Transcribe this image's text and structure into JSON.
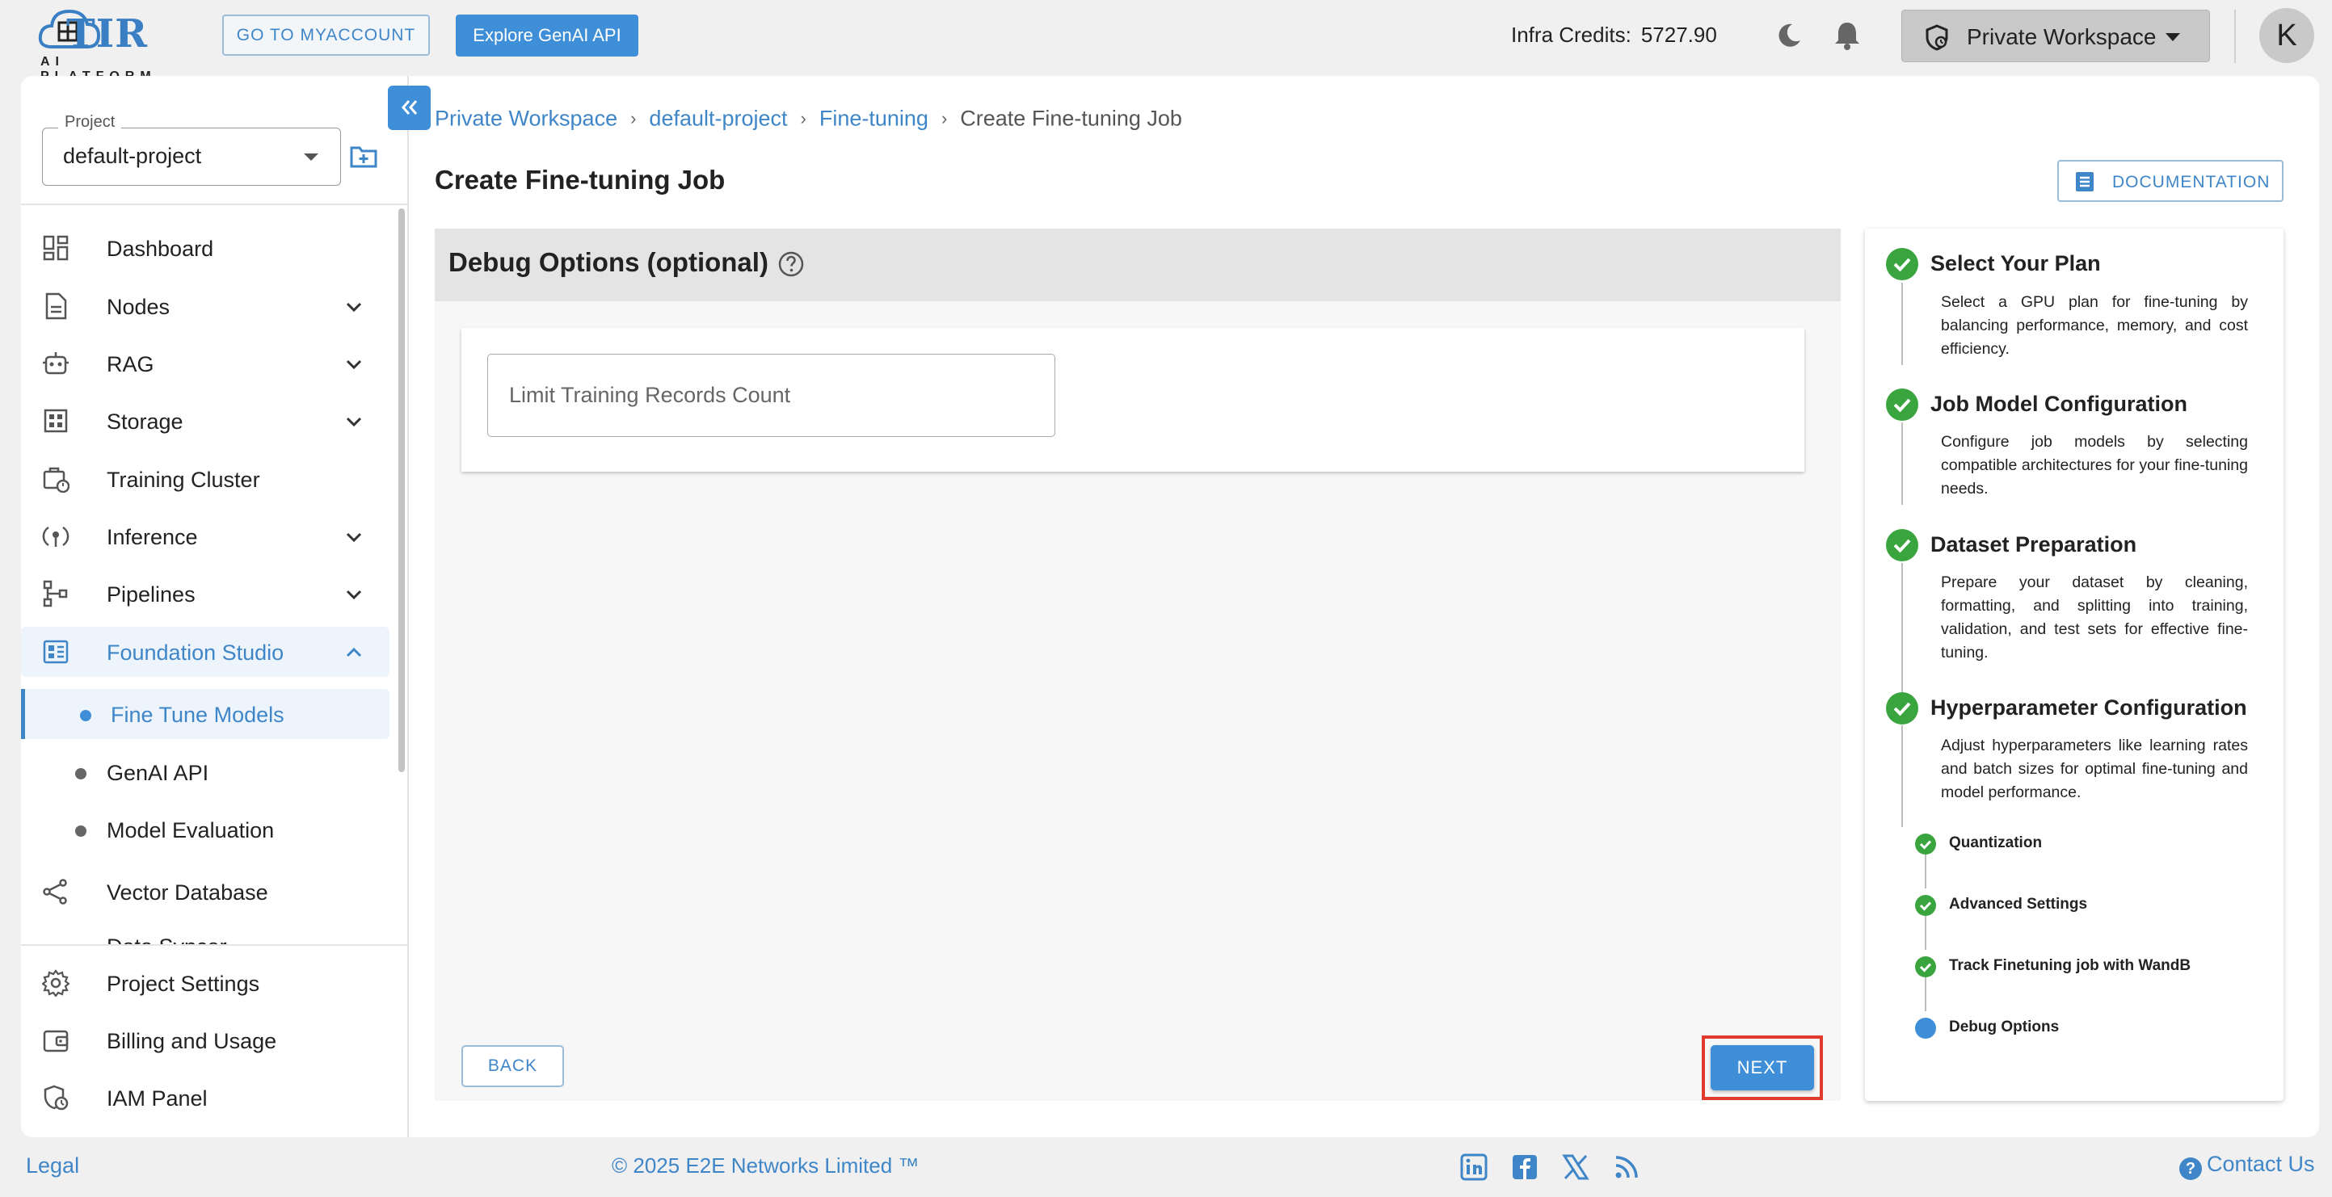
{
  "header": {
    "logo_text": "TIR",
    "logo_sub": "AI PLATFORM",
    "myaccount_label": "GO TO MYACCOUNT",
    "genai_label": "Explore GenAI API",
    "credits_label": "Infra Credits:",
    "credits_value": "5727.90",
    "workspace_label": "Private Workspace",
    "avatar_letter": "K",
    "icons": [
      "moon-icon",
      "bell-icon",
      "workspace-icon",
      "chevron-down-icon"
    ]
  },
  "sidebar": {
    "project_label": "Project",
    "project_value": "default-project",
    "items": [
      {
        "label": "Dashboard",
        "icon": "dashboard-icon"
      },
      {
        "label": "Nodes",
        "icon": "document-icon"
      },
      {
        "label": "RAG",
        "icon": "robot-icon"
      },
      {
        "label": "Storage",
        "icon": "storage-icon"
      },
      {
        "label": "Training Cluster",
        "icon": "cluster-icon"
      },
      {
        "label": "Inference",
        "icon": "inference-icon"
      },
      {
        "label": "Pipelines",
        "icon": "pipeline-icon"
      },
      {
        "label": "Foundation Studio",
        "icon": "studio-icon"
      }
    ],
    "sub_items": [
      {
        "label": "Fine Tune Models"
      },
      {
        "label": "GenAI API"
      },
      {
        "label": "Model Evaluation"
      }
    ],
    "after_items": [
      {
        "label": "Vector Database",
        "icon": "vector-icon"
      },
      {
        "label": "Data Syncer",
        "icon": "sync-icon"
      }
    ],
    "bottom_items": [
      {
        "label": "Project Settings",
        "icon": "gear-icon"
      },
      {
        "label": "Billing and Usage",
        "icon": "wallet-icon"
      },
      {
        "label": "IAM Panel",
        "icon": "iam-icon"
      }
    ]
  },
  "breadcrumb": [
    "Private Workspace",
    "default-project",
    "Fine-tuning",
    "Create Fine-tuning Job"
  ],
  "page_title": "Create Fine-tuning Job",
  "doc_label": "DOCUMENTATION",
  "form": {
    "section_title": "Debug Options (optional)",
    "limit_placeholder": "Limit Training Records Count",
    "limit_value": "",
    "back_label": "BACK",
    "next_label": "NEXT"
  },
  "stepper": {
    "steps": [
      {
        "title": "Select Your Plan",
        "desc": "Select a GPU plan for fine-tuning by balancing performance, memory, and cost efficiency."
      },
      {
        "title": "Job Model Configuration",
        "desc": "Configure job models by selecting compatible architectures for your fine-tuning needs."
      },
      {
        "title": "Dataset Preparation",
        "desc": "Prepare your dataset by cleaning, formatting, and splitting into training, validation, and test sets for effective fine-tuning."
      },
      {
        "title": "Hyperparameter Configuration",
        "desc": "Adjust hyperparameters like learning rates and batch sizes for optimal fine-tuning and model performance."
      }
    ],
    "sub_steps": [
      "Quantization",
      "Advanced Settings",
      "Track Finetuning job with WandB",
      "Debug Options"
    ]
  },
  "footer": {
    "legal": "Legal",
    "copyright": "© 2025 E2E Networks Limited ™",
    "contact": "Contact Us",
    "social": [
      "linkedin-icon",
      "facebook-icon",
      "x-icon",
      "rss-icon"
    ]
  },
  "colors": {
    "accent": "#3f8fd8",
    "success": "#3aa53f",
    "highlight": "#e03b2c"
  }
}
